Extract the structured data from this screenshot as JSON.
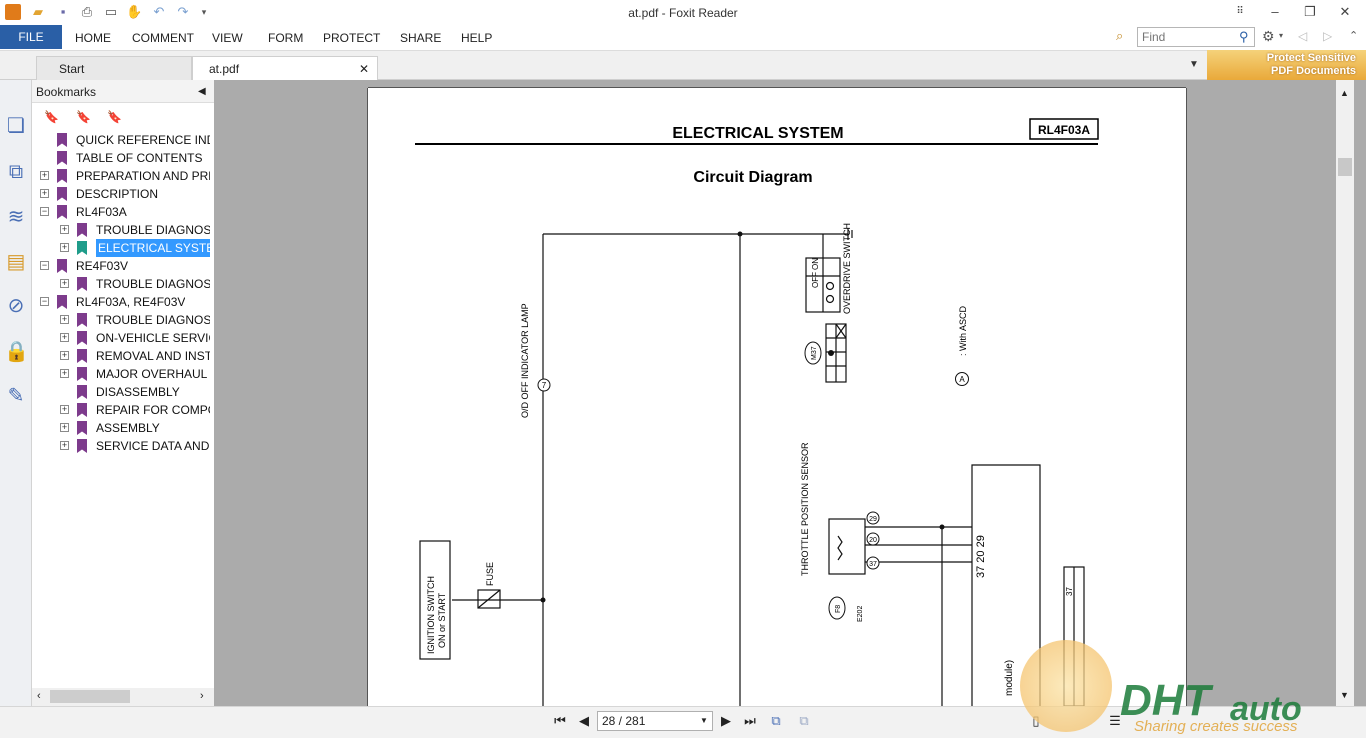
{
  "window": {
    "title": "at.pdf - Foxit Reader"
  },
  "ribbon": {
    "file_label": "FILE",
    "menu": [
      "HOME",
      "COMMENT",
      "VIEW",
      "FORM",
      "PROTECT",
      "SHARE",
      "HELP"
    ],
    "find_placeholder": "Find"
  },
  "tabs": {
    "start_label": "Start",
    "doc_label": "at.pdf"
  },
  "banner": {
    "line1": "Protect Sensitive",
    "line2": "PDF Documents"
  },
  "bookmarks": {
    "title": "Bookmarks",
    "items": [
      {
        "label": "QUICK REFERENCE INDE",
        "level": 0,
        "expander": "none"
      },
      {
        "label": "TABLE OF CONTENTS",
        "level": 0,
        "expander": "none"
      },
      {
        "label": "PREPARATION AND PRE",
        "level": 0,
        "expander": "plus"
      },
      {
        "label": "DESCRIPTION",
        "level": 0,
        "expander": "plus"
      },
      {
        "label": "RL4F03A",
        "level": 0,
        "expander": "minus"
      },
      {
        "label": "TROUBLE DIAGNOSE",
        "level": 1,
        "expander": "plus"
      },
      {
        "label": "ELECTRICAL SYSTEM",
        "level": 1,
        "expander": "plus",
        "selected": true
      },
      {
        "label": "RE4F03V",
        "level": 0,
        "expander": "minus"
      },
      {
        "label": "TROUBLE DIAGNOSE",
        "level": 1,
        "expander": "plus"
      },
      {
        "label": "RL4F03A, RE4F03V",
        "level": 0,
        "expander": "minus"
      },
      {
        "label": "TROUBLE DIAGNOSE",
        "level": 1,
        "expander": "plus"
      },
      {
        "label": "ON-VEHICLE SERVICE",
        "level": 1,
        "expander": "plus"
      },
      {
        "label": "REMOVAL AND INSTA",
        "level": 1,
        "expander": "plus"
      },
      {
        "label": "MAJOR OVERHAUL",
        "level": 1,
        "expander": "plus"
      },
      {
        "label": "DISASSEMBLY",
        "level": 1,
        "expander": "none"
      },
      {
        "label": "REPAIR FOR COMPON",
        "level": 1,
        "expander": "plus"
      },
      {
        "label": "ASSEMBLY",
        "level": 1,
        "expander": "plus"
      },
      {
        "label": "SERVICE DATA AND",
        "level": 1,
        "expander": "plus"
      }
    ]
  },
  "document": {
    "section_title": "ELECTRICAL SYSTEM",
    "model_code": "RL4F03A",
    "heading": "Circuit Diagram",
    "labels": {
      "overdrive_switch": "OVERDRIVE SWITCH",
      "sw_off": "OFF",
      "sw_on": "ON",
      "connector_m37": "M37",
      "with_ascd": ": With ASCD",
      "circle_a": "A",
      "od_lamp": "O/D OFF INDICATOR LAMP",
      "circle_7": "7",
      "ignition": "IGNITION SWITCH",
      "ignition2": "ON or START",
      "fuse": "FUSE",
      "throttle": "THROTTLE POSITION SENSOR",
      "pin29": "29",
      "pin20": "20",
      "pin37": "37",
      "pins_vertical": "37 20 29",
      "connector_f8": "F8",
      "connector_e202": "E202",
      "module": "module)",
      "pin37b": "37"
    }
  },
  "status": {
    "page_indicator": "28 / 281"
  },
  "watermark": {
    "brand": "DHT",
    "suffix": "auto",
    "tagline": "Sharing creates success"
  },
  "colors": {
    "file_tab": "#2a5fa6",
    "bookmark_flag": "#7d3b8c",
    "selection": "#3399ff"
  }
}
